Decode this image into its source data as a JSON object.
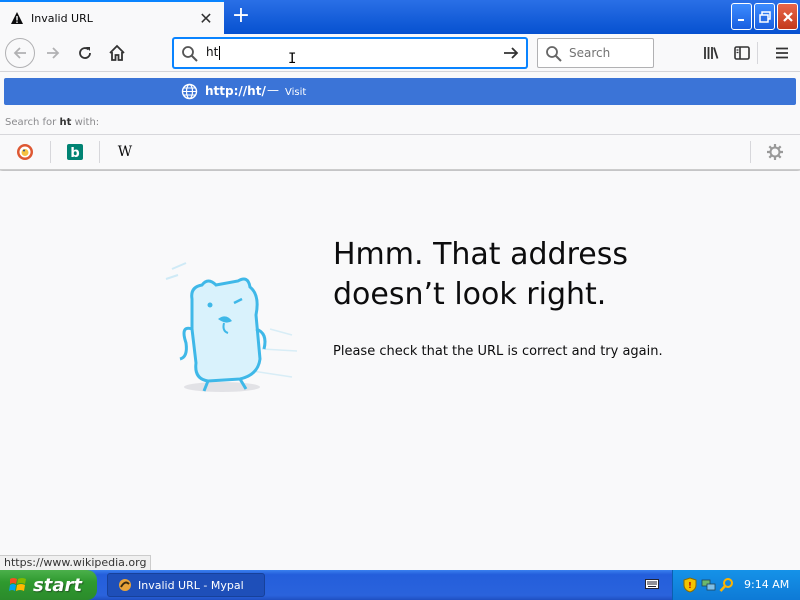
{
  "tab": {
    "title": "Invalid URL",
    "close": "✕",
    "new_tab": "+"
  },
  "window_controls": {
    "minimize": "‗",
    "maximize": "❐",
    "close": "✕"
  },
  "urlbar": {
    "value": "ht",
    "cursor": "I"
  },
  "searchbar": {
    "placeholder": "Search"
  },
  "suggestion": {
    "url": "http://ht/",
    "dash": "—",
    "action": "Visit"
  },
  "search_for": {
    "prefix": "Search for",
    "term": "ht",
    "suffix": "with:"
  },
  "engines": [
    {
      "name": "duckduckgo-icon"
    },
    {
      "name": "bing-icon",
      "letter": "b"
    },
    {
      "name": "wikipedia-icon",
      "letter": "W"
    }
  ],
  "error": {
    "heading": "Hmm. That address doesn’t look right.",
    "message": "Please check that the URL is correct and try again."
  },
  "status_url": "https://www.wikipedia.org",
  "taskbar": {
    "start_label": "start",
    "task_label": "Invalid URL - Mypal",
    "clock": "9:14 AM"
  },
  "colors": {
    "accent": "#0a84ff",
    "suggestion_bg": "#3b74d7",
    "taskbar": "#245edb",
    "start_green": "#2f9a2f"
  }
}
